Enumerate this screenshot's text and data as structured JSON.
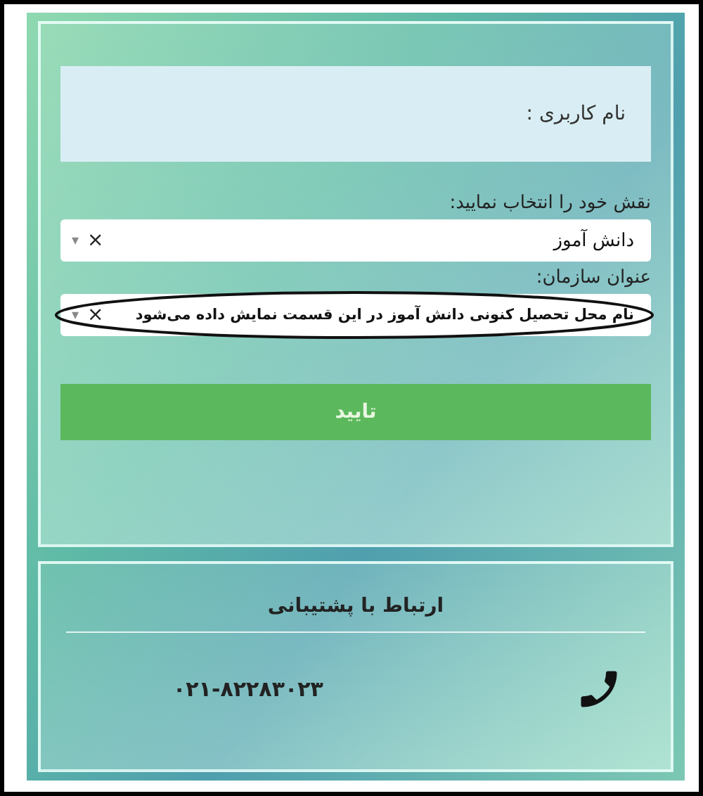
{
  "login_form": {
    "username": {
      "placeholder": "نام کاربری :"
    },
    "role": {
      "label": "نقش خود را انتخاب نمایید:",
      "value": "دانش آموز",
      "clear": "×",
      "caret": "▾"
    },
    "organization": {
      "label": "عنوان سازمان:",
      "value": "نام محل تحصیل کنونی دانش آموز در این قسمت نمایش داده می‌شود",
      "clear": "×",
      "caret": "▾",
      "annotated": true
    },
    "submit": "تایید"
  },
  "support": {
    "title": "ارتباط با پشتیبانی",
    "phone": "۰۲۱-۸۲۲۸۳۰۲۳"
  }
}
